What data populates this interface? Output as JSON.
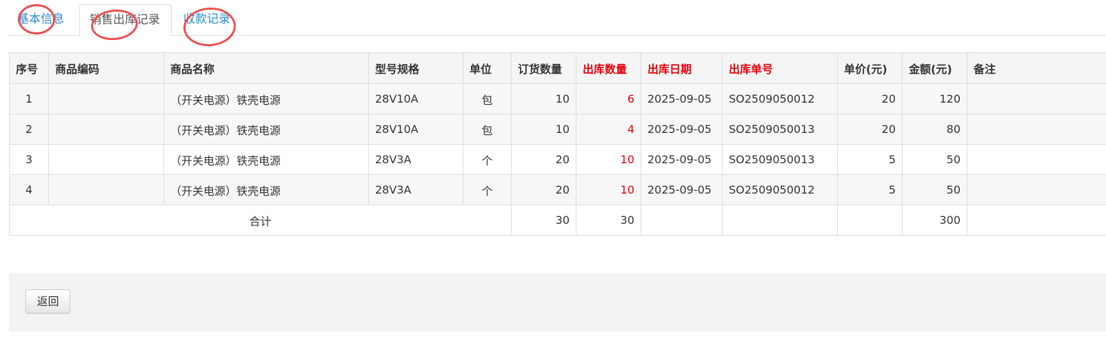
{
  "tabs": [
    {
      "label": "基本信息",
      "active": false
    },
    {
      "label": "销售出库记录",
      "active": true
    },
    {
      "label": "收款记录",
      "active": false
    }
  ],
  "table": {
    "headers": [
      "序号",
      "商品编码",
      "商品名称",
      "型号规格",
      "单位",
      "订货数量",
      "出库数量",
      "出库日期",
      "出库单号",
      "单价(元)",
      "金额(元)",
      "备注"
    ],
    "highlighted_headers": [
      "出库数量",
      "出库日期",
      "出库单号"
    ],
    "rows": [
      {
        "index": "1",
        "code": "",
        "name": "（开关电源）铁壳电源",
        "spec": "28V10A",
        "unit": "包",
        "order_qty": "10",
        "out_qty": "6",
        "out_date": "2025-09-05",
        "out_no": "SO2509050012",
        "unit_price": "20",
        "amount": "120",
        "remark": ""
      },
      {
        "index": "2",
        "code": "",
        "name": "（开关电源）铁壳电源",
        "spec": "28V10A",
        "unit": "包",
        "order_qty": "10",
        "out_qty": "4",
        "out_date": "2025-09-05",
        "out_no": "SO2509050013",
        "unit_price": "20",
        "amount": "80",
        "remark": ""
      },
      {
        "index": "3",
        "code": "",
        "name": "（开关电源）铁壳电源",
        "spec": "28V3A",
        "unit": "个",
        "order_qty": "20",
        "out_qty": "10",
        "out_date": "2025-09-05",
        "out_no": "SO2509050013",
        "unit_price": "5",
        "amount": "50",
        "remark": ""
      },
      {
        "index": "4",
        "code": "",
        "name": "（开关电源）铁壳电源",
        "spec": "28V3A",
        "unit": "个",
        "order_qty": "20",
        "out_qty": "10",
        "out_date": "2025-09-05",
        "out_no": "SO2509050012",
        "unit_price": "5",
        "amount": "50",
        "remark": ""
      }
    ],
    "total": {
      "label": "合计",
      "order_qty": "30",
      "out_qty": "30",
      "amount": "300"
    }
  },
  "footer": {
    "back_label": "返回"
  },
  "colors": {
    "link": "#2a8bd0",
    "highlight_red": "#e8000b",
    "annotation_circle": "#ef4e4e"
  }
}
